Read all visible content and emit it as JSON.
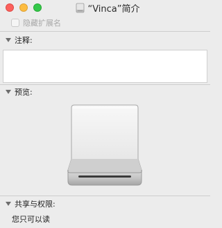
{
  "window": {
    "title": "“Vinca”简介",
    "title_icon": "drive-icon"
  },
  "options": {
    "hide_extension_label": "隐藏扩展名",
    "hide_extension_checked": false
  },
  "sections": {
    "comments": {
      "label": "注释:",
      "value": ""
    },
    "preview": {
      "label": "预览:",
      "icon": "external-drive-icon"
    },
    "sharing": {
      "label": "共享与权限:",
      "value": "您只可以读"
    }
  }
}
